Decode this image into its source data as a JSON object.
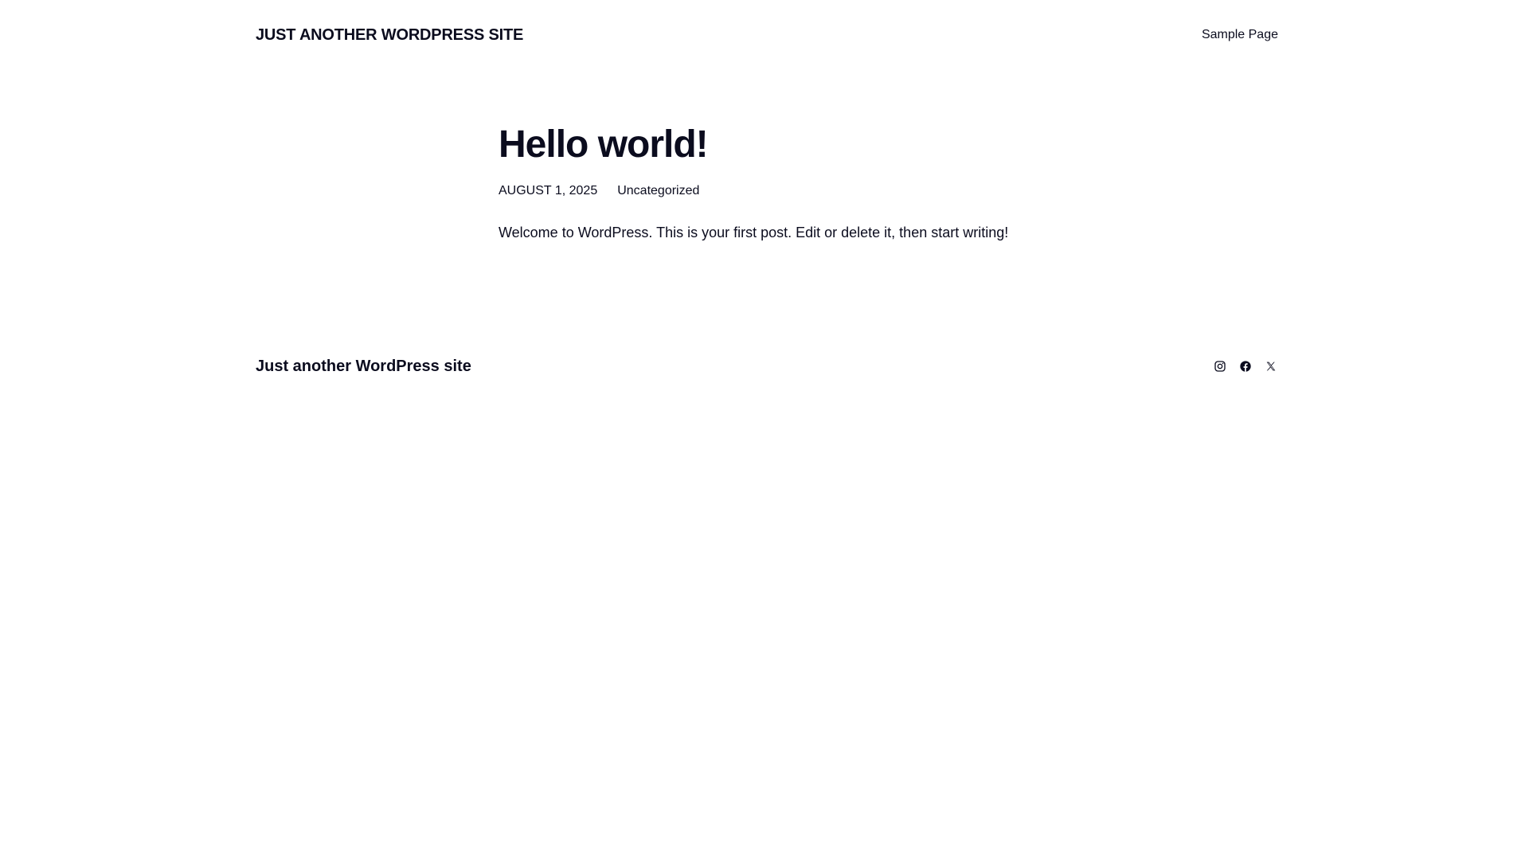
{
  "header": {
    "site_title": "JUST ANOTHER WORDPRESS SITE",
    "nav": [
      {
        "label": "Sample Page"
      }
    ]
  },
  "post": {
    "title": "Hello world!",
    "date": "AUGUST 1, 2025",
    "category": "Uncategorized",
    "content": "Welcome to WordPress. This is your first post. Edit or delete it, then start writing!"
  },
  "footer": {
    "site_title": "Just another WordPress site",
    "social_icons": [
      "instagram-icon",
      "facebook-icon",
      "x-icon"
    ]
  },
  "colors": {
    "text": "#0b0c1e",
    "background": "#ffffff"
  }
}
